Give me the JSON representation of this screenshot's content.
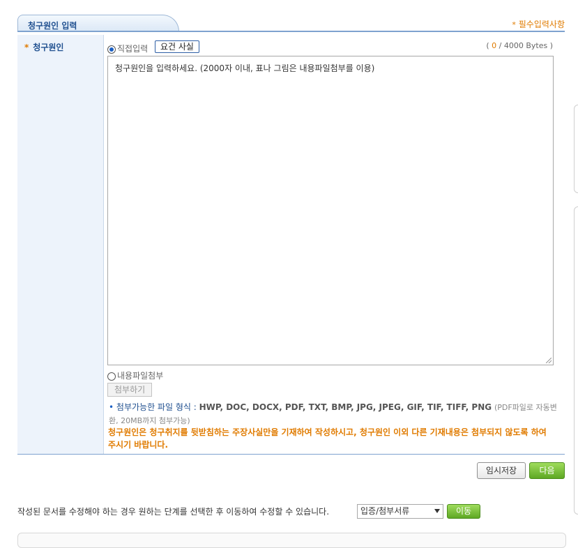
{
  "header": {
    "tab_label": "청구원인 입력",
    "required_note": "필수입력사항",
    "required_star": "*"
  },
  "field": {
    "label": "청구원인",
    "label_star": "*"
  },
  "input_mode": {
    "direct_label": "직접입력",
    "direct_selected": true,
    "fact_button": "요건 사실",
    "file_label": "내용파일첨부",
    "file_selected": false
  },
  "byte_counter": {
    "open": "(",
    "current": "0",
    "rest": "/ 4000 Bytes )"
  },
  "textarea": {
    "placeholder": "청구원인을 입력하세요. (2000자 이내, 표나 그림은 내용파일첨부를 이용)"
  },
  "attach": {
    "button": "첨부하기",
    "formats_label": "첨부가능한 파일 형식 :",
    "formats_list": "HWP, DOC, DOCX, PDF, TXT, BMP, JPG, JPEG, GIF, TIF, TIFF, PNG",
    "formats_note": "(PDF파일로 자동변환, 20MB까지 첨부가능)"
  },
  "warning": "청구원인은 청구취지를 뒷받침하는 주장사실만을 기재하여 작성하시고, 청구원인 이외 다른 기재내용은 첨부되지 않도록 하여 주시기 바랍니다.",
  "actions": {
    "save": "임시저장",
    "next": "다음"
  },
  "navigate": {
    "text": "작성된 문서를 수정해야 하는 경우 원하는 단계를 선택한 후 이동하여 수정할 수 있습니다.",
    "select_value": "입증/첨부서류",
    "move": "이동"
  },
  "colors": {
    "accent_blue": "#1f4f8f",
    "accent_orange": "#e07b00",
    "button_green": "#5ea823"
  }
}
